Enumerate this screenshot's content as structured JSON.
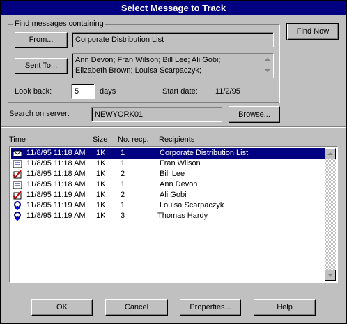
{
  "window": {
    "title": "Select Message to Track"
  },
  "find": {
    "group_label": "Find messages containing",
    "from_button": "From...",
    "from_value": "Corporate Distribution List",
    "sent_to_button": "Sent To...",
    "sent_to_line1": "Ann Devon; Fran Wilson; Bill Lee; Ali Gobi;",
    "sent_to_line2": "Elizabeth Brown; Louisa Scarpaczyk;",
    "look_back_label": "Look back:",
    "look_back_value": "5",
    "days_label": "days",
    "start_date_label": "Start date:",
    "start_date_value": "11/2/95"
  },
  "find_now_button": "Find Now",
  "server": {
    "label": "Search on server:",
    "value": "NEWYORK01",
    "browse_button": "Browse..."
  },
  "list": {
    "headers": {
      "time": "Time",
      "size": "Size",
      "recp": "No. recp.",
      "recipients": "Recipients"
    },
    "rows": [
      {
        "icon": "envelope-icon",
        "time": "11/8/95  11:18 AM",
        "size": "1K",
        "recp": "1",
        "recipients": "Corporate Distribution List"
      },
      {
        "icon": "message-form-icon",
        "time": "11/8/95  11:18 AM",
        "size": "1K",
        "recp": "1",
        "recipients": "Fran Wilson"
      },
      {
        "icon": "delivery-check-icon",
        "time": "11/8/95  11:18 AM",
        "size": "1K",
        "recp": "2",
        "recipients": "Bill Lee"
      },
      {
        "icon": "message-form-icon",
        "time": "11/8/95  11:18 AM",
        "size": "1K",
        "recp": "1",
        "recipients": "Ann Devon"
      },
      {
        "icon": "delivery-check-icon",
        "time": "11/8/95  11:19 AM",
        "size": "1K",
        "recp": "2",
        "recipients": "Ali Gobi"
      },
      {
        "icon": "read-receipt-icon",
        "time": "11/8/95  11:19 AM",
        "size": "1K",
        "recp": "1",
        "recipients": "Louisa Scarpaczyk"
      },
      {
        "icon": "read-receipt-icon",
        "time": "11/8/95  11:19 AM",
        "size": "1K",
        "recp": "3",
        "recipients": "Thomas Hardy"
      }
    ]
  },
  "buttons": {
    "ok": "OK",
    "cancel": "Cancel",
    "properties": "Properties...",
    "help": "Help"
  },
  "colors": {
    "title_bar": "#000080",
    "selection": "#000080",
    "face": "#c0c0c0"
  }
}
